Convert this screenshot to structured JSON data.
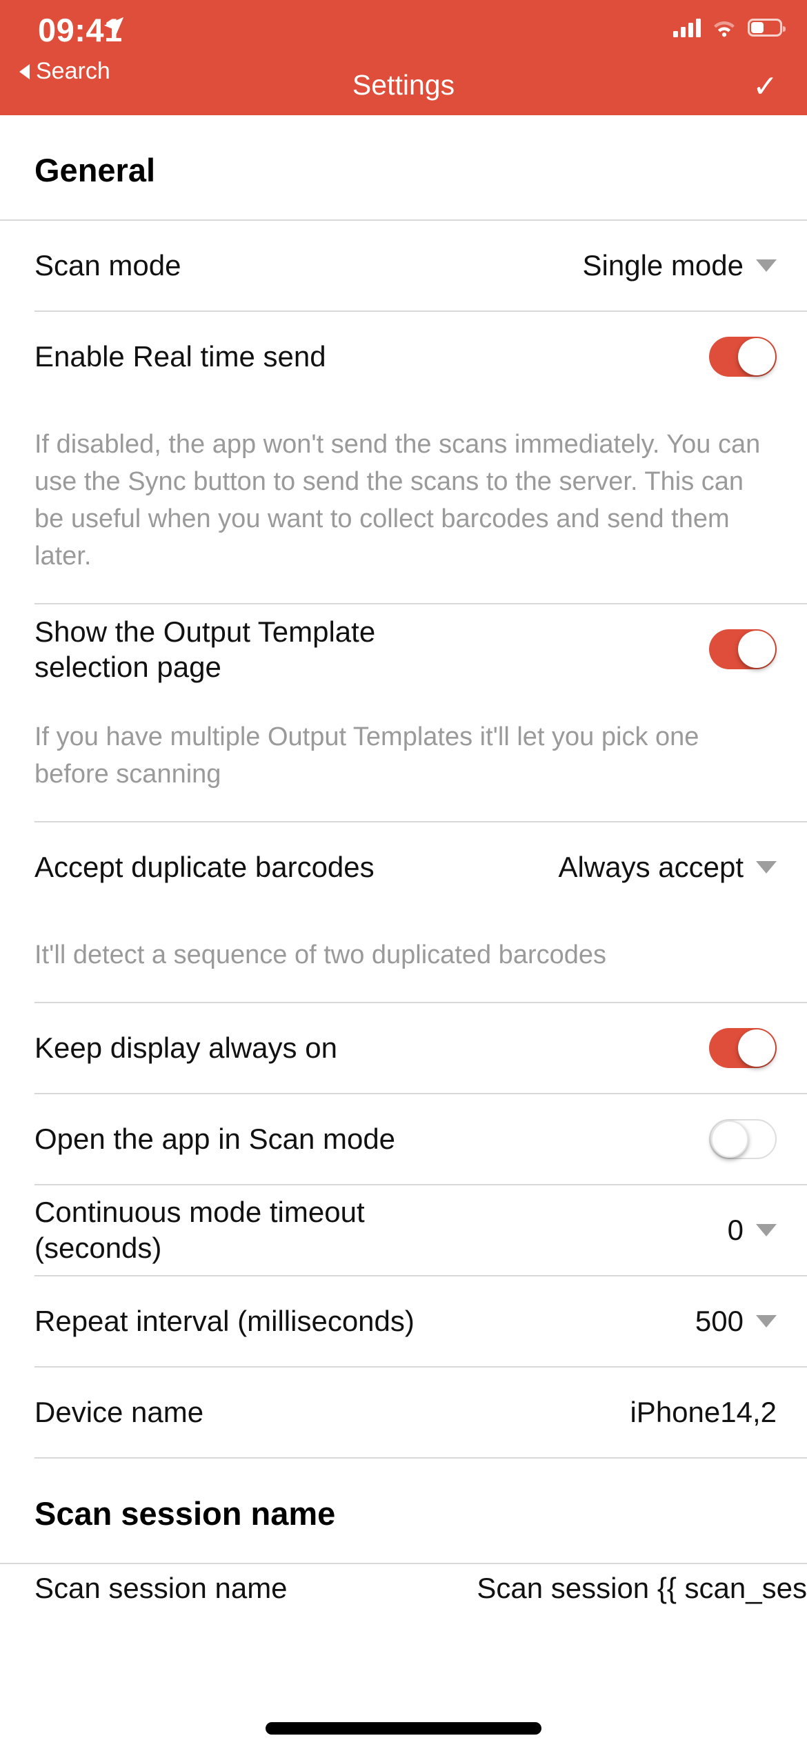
{
  "status_bar": {
    "time": "09:41",
    "location_icon": "location-arrow-icon",
    "signal_icon": "cellular-signal-icon",
    "wifi_icon": "wifi-icon",
    "battery_icon": "battery-icon"
  },
  "nav": {
    "back_label": "Search",
    "title": "Settings",
    "confirm_icon": "checkmark-icon",
    "bar_color": "#de4e3a"
  },
  "sections": {
    "general": {
      "header": "General",
      "scan_mode": {
        "label": "Scan mode",
        "value": "Single mode"
      },
      "real_time_send": {
        "label": "Enable Real time send",
        "state": "on"
      },
      "real_time_send_help": "If disabled, the app won't send the scans immediately. You can use the Sync button to send the scans to the server. This can be useful when you want to collect barcodes and send them later.",
      "output_template_page": {
        "label": "Show the Output Template selection page",
        "state": "on"
      },
      "output_template_help": "If you have multiple Output Templates it'll let you pick one before scanning",
      "duplicate_barcodes": {
        "label": "Accept duplicate barcodes",
        "value": "Always accept"
      },
      "duplicate_barcodes_help": "It'll detect a sequence of two duplicated barcodes",
      "keep_display_on": {
        "label": "Keep display always on",
        "state": "on"
      },
      "open_in_scan_mode": {
        "label": "Open the app in Scan mode",
        "state": "off"
      },
      "continuous_timeout": {
        "label": "Continuous mode timeout (seconds)",
        "value": "0"
      },
      "repeat_interval": {
        "label": "Repeat interval (milliseconds)",
        "value": "500"
      },
      "device_name": {
        "label": "Device name",
        "value": "iPhone14,2"
      }
    },
    "scan_session": {
      "header": "Scan session name",
      "row": {
        "label": "Scan session name",
        "value": "Scan session {{ scan_ses"
      }
    }
  },
  "colors": {
    "accent": "#de4e3a",
    "toggle_on": "#de4e3a",
    "helper_text": "#9a9a9a",
    "divider": "#d8d8d8"
  }
}
